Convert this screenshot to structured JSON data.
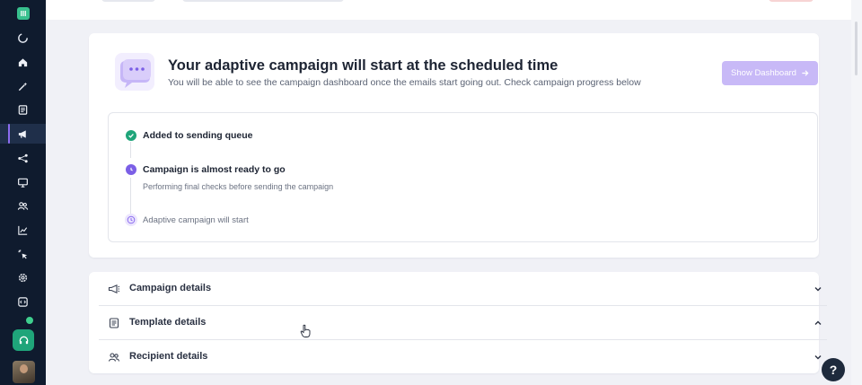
{
  "app": {
    "logo_text": "III"
  },
  "hero": {
    "title": "Your adaptive campaign will start at the scheduled time",
    "subtitle": "You will be able to see the campaign dashboard once the emails start going out. Check campaign progress below",
    "dashboard_button": "Show Dashboard",
    "illustration_icon": "chat-bubble-illustration"
  },
  "steps": [
    {
      "label": "Added to sending queue",
      "status": "done",
      "icon": "check-circle-icon",
      "color": "#1fa57a"
    },
    {
      "label": "Campaign is almost ready to go",
      "description": "Performing final checks before sending the campaign",
      "status": "in-progress",
      "icon": "clock-icon",
      "color": "#7b5fe6"
    },
    {
      "label": "Adaptive campaign will start",
      "status": "pending",
      "icon": "clock-outline-icon",
      "color": "#b6a6f2"
    }
  ],
  "accordion": [
    {
      "label": "Campaign details",
      "icon": "megaphone-icon",
      "expanded": false
    },
    {
      "label": "Template details",
      "icon": "document-icon",
      "expanded": true
    },
    {
      "label": "Recipient details",
      "icon": "users-icon",
      "expanded": false
    }
  ],
  "help": {
    "label": "?"
  },
  "colors": {
    "sidebar_bg": "#0f1b2e",
    "accent": "#8b6cf0",
    "button_disabled": "#c8b9f7",
    "success": "#1fa57a",
    "page_bg": "#f0f1f6"
  }
}
